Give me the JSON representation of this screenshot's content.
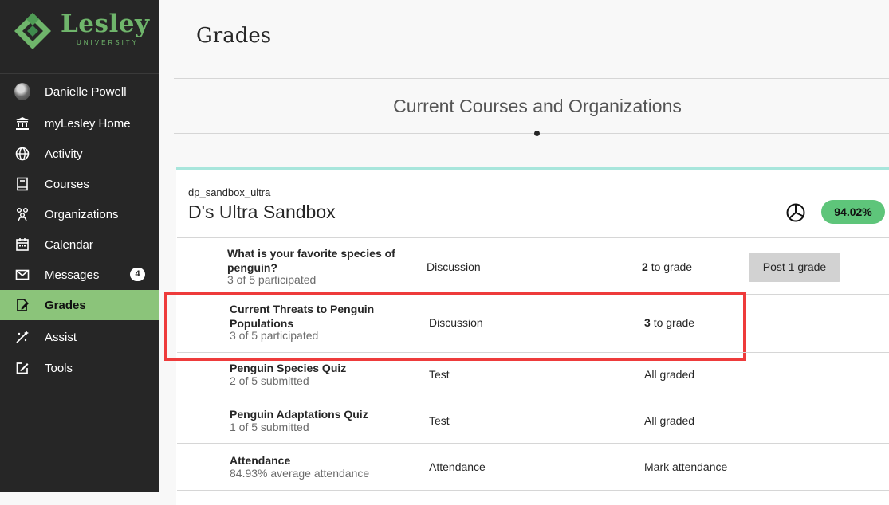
{
  "brand": {
    "name": "Lesley",
    "sub": "UNIVERSITY"
  },
  "sidebar": {
    "items": [
      {
        "label": "Danielle Powell",
        "icon": "avatar"
      },
      {
        "label": "myLesley Home",
        "icon": "institution-icon"
      },
      {
        "label": "Activity",
        "icon": "globe-icon"
      },
      {
        "label": "Courses",
        "icon": "courses-icon"
      },
      {
        "label": "Organizations",
        "icon": "organizations-icon"
      },
      {
        "label": "Calendar",
        "icon": "calendar-icon"
      },
      {
        "label": "Messages",
        "icon": "envelope-icon",
        "badge": "4"
      },
      {
        "label": "Grades",
        "icon": "grades-icon",
        "active": true
      },
      {
        "label": "Assist",
        "icon": "assist-icon"
      },
      {
        "label": "Tools",
        "icon": "tools-icon"
      }
    ]
  },
  "page": {
    "title": "Grades",
    "section_title": "Current Courses and Organizations"
  },
  "course": {
    "id": "dp_sandbox_ultra",
    "name": "D's Ultra Sandbox",
    "overall_grade": "94.02%",
    "grade_color": "#5ec57a",
    "items": [
      {
        "title": "What is your favorite species of penguin?",
        "sub": "3 of 5 participated",
        "type": "Discussion",
        "count": "2",
        "status": "to grade",
        "action": "Post 1 grade",
        "icon": "discussion-icon"
      },
      {
        "title": "Current Threats to Penguin Populations",
        "sub": "3 of 5 participated",
        "type": "Discussion",
        "count": "3",
        "status": "to grade",
        "icon": "discussion-icon"
      },
      {
        "title": "Penguin Species Quiz",
        "sub": "2 of 5 submitted",
        "type": "Test",
        "status": "All graded",
        "icon": "test-icon"
      },
      {
        "title": "Penguin Adaptations Quiz",
        "sub": "1 of 5 submitted",
        "type": "Test",
        "status": "All graded",
        "icon": "test-icon"
      },
      {
        "title": "Attendance",
        "sub": "84.93% average attendance",
        "type": "Attendance",
        "status": "Mark attendance",
        "icon": "attendance-icon"
      }
    ]
  },
  "colors": {
    "sidebar_bg": "#262626",
    "active_nav": "#8bc47a",
    "card_accent": "#a8e6dc",
    "highlight": "#ee3b3b"
  }
}
